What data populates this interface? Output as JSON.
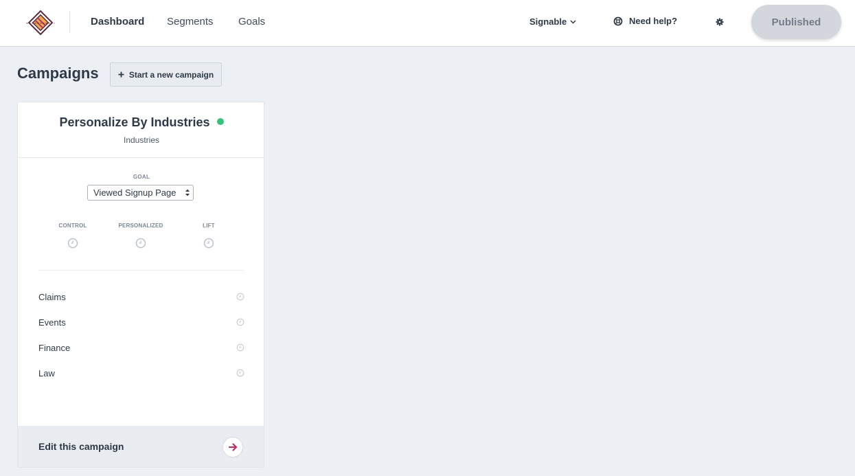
{
  "nav": {
    "items": [
      {
        "label": "Dashboard",
        "active": true
      },
      {
        "label": "Segments",
        "active": false
      },
      {
        "label": "Goals",
        "active": false
      }
    ],
    "account_label": "Signable",
    "help_label": "Need help?",
    "publish_label": "Published"
  },
  "page": {
    "title": "Campaigns",
    "new_campaign_label": "Start a new campaign"
  },
  "campaign": {
    "title": "Personalize By Industries",
    "subtitle": "Industries",
    "status_color": "#35c27a",
    "goal_label": "GOAL",
    "goal_value": "Viewed Signup Page",
    "metrics": [
      {
        "label": "CONTROL"
      },
      {
        "label": "PERSONALIZED"
      },
      {
        "label": "LIFT"
      }
    ],
    "segments": [
      {
        "name": "Claims"
      },
      {
        "name": "Events"
      },
      {
        "name": "Finance"
      },
      {
        "name": "Law"
      }
    ],
    "edit_label": "Edit this campaign"
  },
  "colors": {
    "accent": "#b3336b",
    "status_active": "#35c27a"
  }
}
